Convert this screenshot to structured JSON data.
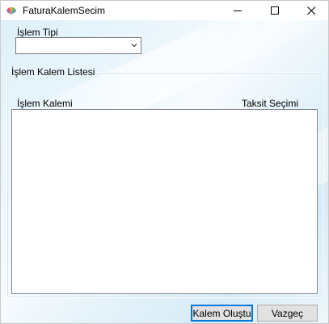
{
  "window": {
    "title": "FaturaKalemSecim"
  },
  "form": {
    "islem_tipi_label": "İşlem Tipi",
    "islem_tipi_value": "",
    "group_title": "İşlem Kalem Listesi",
    "col_islem_kalemi": "İşlem Kalemi",
    "col_taksit_secimi": "Taksit Seçimi"
  },
  "buttons": {
    "create_label": "Kalem Oluştu",
    "cancel_label": "Vazgeç"
  },
  "colors": {
    "accent": "#0078d7",
    "background_tint": "#dff0f9"
  }
}
